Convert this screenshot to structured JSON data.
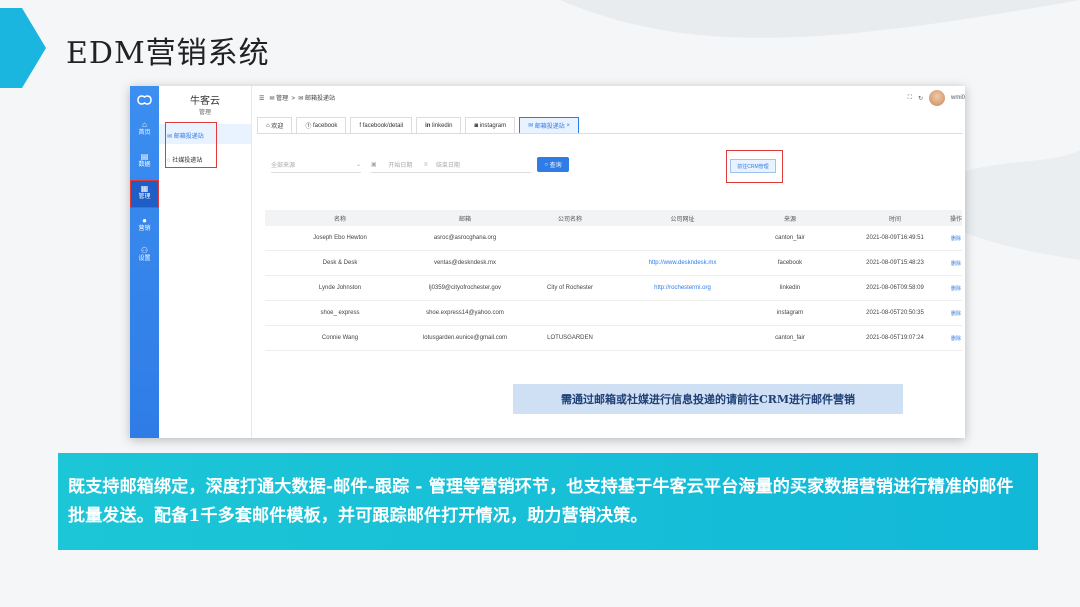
{
  "slide": {
    "title": "EDM营销系统",
    "caption": "既支持邮箱绑定，深度打通大数据-邮件-跟踪 - 管理等营销环节，也支持基于牛客云平台海量的买家数据营销进行精准的邮件批量发送。配备1千多套邮件模板，并可跟踪邮件打开情况，助力营销决策。",
    "accent": "#12b8d8"
  },
  "rail": {
    "items": [
      {
        "icon": "home-icon",
        "label": "首页"
      },
      {
        "icon": "data-icon",
        "label": "数据"
      },
      {
        "icon": "manage-icon",
        "label": "管理"
      },
      {
        "icon": "marketing-icon",
        "label": "营销"
      },
      {
        "icon": "user-settings-icon",
        "label": "设置"
      }
    ]
  },
  "sidebar": {
    "brand": "牛客云",
    "section": "管理",
    "items": [
      {
        "label": "邮箱投递站"
      },
      {
        "label": "社媒投递站"
      }
    ]
  },
  "header": {
    "breadcrumb": [
      "管理",
      "邮箱投递站"
    ],
    "user": "wmi0"
  },
  "tabs": [
    {
      "label": "欢迎",
      "icon": "home-icon"
    },
    {
      "label": "facebook",
      "icon": "facebook-icon"
    },
    {
      "label": "facebook/detail",
      "icon": "facebook-icon"
    },
    {
      "label": "linkedin",
      "icon": "linkedin-icon"
    },
    {
      "label": "instagram",
      "icon": "instagram-icon"
    },
    {
      "label": "邮箱投递站",
      "icon": "mail-icon",
      "closable": true
    }
  ],
  "filters": {
    "source_placeholder": "全部来源",
    "start_placeholder": "开始日期",
    "end_placeholder": "结束日期",
    "query_label": "查询",
    "crm_button": "前往CRM管理"
  },
  "table": {
    "columns": [
      "名称",
      "邮箱",
      "公司名称",
      "公司网址",
      "来源",
      "时间",
      "操作"
    ],
    "rows": [
      [
        "Joseph Ebo Hewton",
        "asroc@asrocghana.org",
        "",
        "",
        "canton_fair",
        "2021-08-09T16:49:51",
        "删除"
      ],
      [
        "Desk & Desk",
        "ventas@deskndesk.mx",
        "",
        "http://www.deskndesk.mx",
        "facebook",
        "2021-08-09T15:48:23",
        "删除"
      ],
      [
        "Lynde Johnston",
        "lj0359@cityofrochester.gov",
        "City of Rochester",
        "http://rochestermi.org",
        "linkedin",
        "2021-08-06T09:58:09",
        "删除"
      ],
      [
        "shoe_ express",
        "shoe.express14@yahoo.com",
        "",
        "",
        "instagram",
        "2021-08-05T20:50:35",
        "删除"
      ],
      [
        "Connie Wang",
        "lotusgarden.eunice@gmail.com",
        "LOTUSGARDEN",
        "",
        "canton_fair",
        "2021-08-05T19:07:24",
        "删除"
      ]
    ]
  },
  "notice": "需通过邮箱或社媒进行信息投递的请前往CRM进行邮件营销"
}
